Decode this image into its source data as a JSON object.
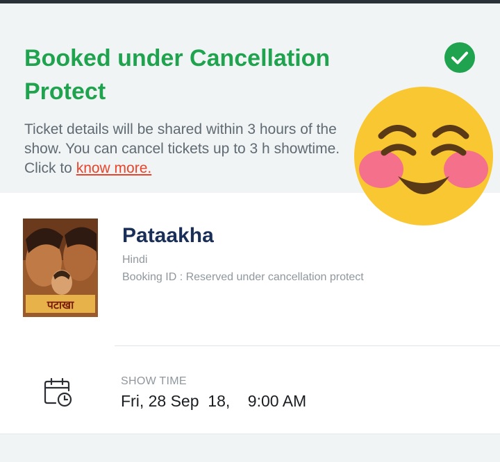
{
  "colors": {
    "success_green": "#1fa34e",
    "link_red": "#e8442b",
    "title_navy": "#1a2f57",
    "banner_bg": "#f1f4f5"
  },
  "banner": {
    "title": "Booked under Cancellation Protect",
    "description": "Ticket details will be shared within 3 hours of the show. You can cancel tickets up to 3 h showtime. Click to ",
    "link_text": "know more.",
    "status_icon": "check-circle-icon"
  },
  "overlay": {
    "emoji": "blushing-smiling-face-emoji"
  },
  "movie": {
    "title": "Pataakha",
    "language": "Hindi",
    "booking_id": "Booking ID : Reserved under cancellation protect",
    "poster_text": "पटाखा"
  },
  "show": {
    "label": "SHOW TIME",
    "value": "Fri, 28 Sep  18,    9:00 AM",
    "icon": "calendar-clock-icon"
  }
}
